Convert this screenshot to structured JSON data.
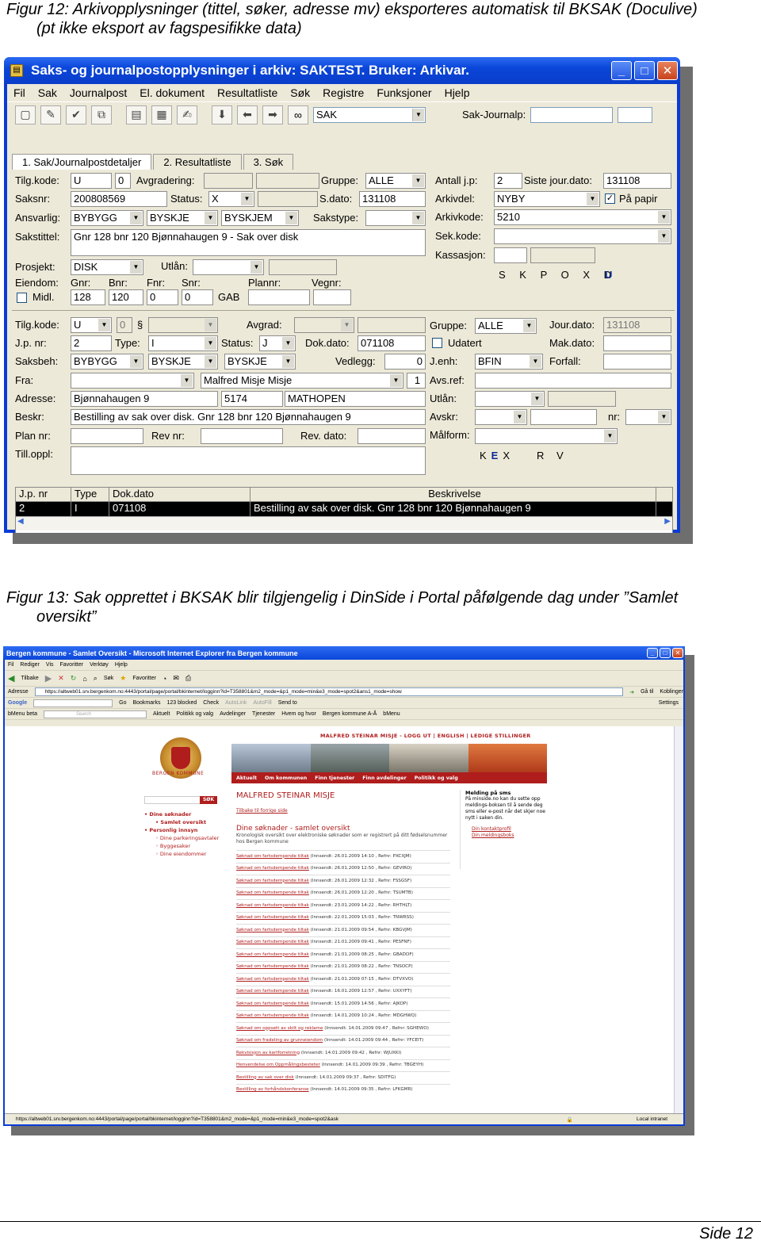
{
  "captions": {
    "fig12_line1": "Figur 12: Arkivopplysninger (tittel, søker, adresse mv) eksporteres automatisk til BKSAK (Doculive)",
    "fig12_line2": "(pt ikke eksport av fagspesifikke data)",
    "fig13_line1": "Figur 13: Sak opprettet i BKSAK blir tilgjengelig i DinSide i Portal påfølgende dag under ”Samlet",
    "fig13_line2": "oversikt”"
  },
  "footer": {
    "page": "Side 12"
  },
  "win1": {
    "title": "Saks- og journalpostopplysninger i arkiv: SAKTEST. Bruker: Arkivar.",
    "menu": [
      "Fil",
      "Sak",
      "Journalpost",
      "El. dokument",
      "Resultatliste",
      "Søk",
      "Registre",
      "Funksjoner",
      "Hjelp"
    ],
    "toolbar": {
      "combo_value": "SAK",
      "sakjournalp_label": "Sak-Journalp:"
    },
    "tabs": [
      "1. Sak/Journalpostdetaljer",
      "2. Resultatliste",
      "3. Søk"
    ],
    "sak": {
      "tilgkode_label": "Tilg.kode:",
      "tilgkode_value": "U",
      "tilgkode_num": "0",
      "avgradering_label": "Avgradering:",
      "gruppe_label": "Gruppe:",
      "gruppe_value": "ALLE",
      "antall_jp_label": "Antall j.p:",
      "antall_jp_value": "2",
      "siste_jour_label": "Siste jour.dato:",
      "siste_jour_value": "131108",
      "saksnr_label": "Saksnr:",
      "saksnr_value": "200808569",
      "status_label": "Status:",
      "status_value": "X",
      "sdato_label": "S.dato:",
      "sdato_value": "131108",
      "arkivdel_label": "Arkivdel:",
      "arkivdel_value": "NYBY",
      "paa_papir_label": "På papir",
      "ansvarlig_label": "Ansvarlig:",
      "ansvarlig_1": "BYBYGG",
      "ansvarlig_2": "BYSKJE",
      "ansvarlig_3": "BYSKJEM",
      "sakstype_label": "Sakstype:",
      "arkivkode_label": "Arkivkode:",
      "arkivkode_value": "5210",
      "sakstittel_label": "Sakstittel:",
      "sakstittel_value": "Gnr 128 bnr 120 Bjønnahaugen 9 - Sak over disk",
      "sekkode_label": "Sek.kode:",
      "kassasjon_label": "Kassasjon:",
      "prosjekt_label": "Prosjekt:",
      "prosjekt_value": "DISK",
      "utlan_label": "Utlån:",
      "skpoxd": "S K P O X D",
      "u_letter": "U",
      "eiendom_label": "Eiendom:",
      "gnr_label": "Gnr:",
      "bnr_label": "Bnr:",
      "fnr_label": "Fnr:",
      "snr_label": "Snr:",
      "plannr_label": "Plannr:",
      "vegnr_label": "Vegnr:",
      "midl_label": "Midl.",
      "gnr_value": "128",
      "bnr_value": "120",
      "fnr_value": "0",
      "snr_value": "0",
      "gab_label": "GAB"
    },
    "jp": {
      "tilgkode_label": "Tilg.kode:",
      "tilgkode_value": "U",
      "tilgkode_num": "0",
      "paragraph": "§",
      "avgrad_label": "Avgrad:",
      "gruppe_label": "Gruppe:",
      "gruppe_value": "ALLE",
      "jourdato_label": "Jour.dato:",
      "jourdato_value": "131108",
      "jpnr_label": "J.p. nr:",
      "jpnr_value": "2",
      "type_label": "Type:",
      "type_value": "I",
      "status_label": "Status:",
      "status_value": "J",
      "dokdato_label": "Dok.dato:",
      "dokdato_value": "071108",
      "udatert_label": "Udatert",
      "makdato_label": "Mak.dato:",
      "saksbeh_label": "Saksbeh:",
      "saksbeh_1": "BYBYGG",
      "saksbeh_2": "BYSKJE",
      "saksbeh_3": "BYSKJE",
      "vedlegg_label": "Vedlegg:",
      "vedlegg_value": "0",
      "jenh_label": "J.enh:",
      "jenh_value": "BFIN",
      "forfall_label": "Forfall:",
      "fra_label": "Fra:",
      "fra_value": "Malfred Misje Misje",
      "fra_num": "1",
      "avsref_label": "Avs.ref:",
      "adresse_label": "Adresse:",
      "adresse_value": "Bjønnahaugen 9",
      "postnr_value": "5174",
      "poststed_value": "MATHOPEN",
      "utlan_label": "Utlån:",
      "beskr_label": "Beskr:",
      "beskr_value": "Bestilling av sak over disk. Gnr 128 bnr 120 Bjønnahaugen 9",
      "avskr_label": "Avskr:",
      "nr_label": "nr:",
      "plannr_label": "Plan nr:",
      "revnr_label": "Rev nr:",
      "revdato_label": "Rev. dato:",
      "malform_label": "Målform:",
      "tilloppl_label": "Till.oppl:",
      "kex_k": "K",
      "kex_e": "E",
      "kex_x": "X",
      "rv": "R V"
    },
    "grid": {
      "headers": [
        "J.p. nr",
        "Type",
        "Dok.dato",
        "Beskrivelse"
      ],
      "rows": [
        [
          "2",
          "I",
          "071108",
          "Bestilling av sak over disk. Gnr 128 bnr 120 Bjønnahaugen 9"
        ]
      ]
    }
  },
  "win2": {
    "title": "Bergen kommune - Samlet Oversikt - Microsoft Internet Explorer fra Bergen kommune",
    "menu": [
      "Fil",
      "Rediger",
      "Vis",
      "Favoritter",
      "Verktøy",
      "Hjelp"
    ],
    "nav": [
      "Tilbake",
      "Søk",
      "Favoritter"
    ],
    "address_label": "Adresse",
    "address": "https://altweb01.srv.bergenkom.no:4443/portal/page/portal/bkinternet/logginn?id=T358801&m2_mode=&p1_mode=min&e3_mode=spot2&ans1_mode=show",
    "goto": "Gå til",
    "links_label": "Koblinger",
    "google_row": [
      "Google",
      "Go",
      "Bookmarks",
      "123 blocked",
      "Check",
      "AutoLink",
      "AutoFill",
      "Send to",
      "Settings"
    ],
    "bmenu_row": [
      "bMenu beta",
      "Search",
      "Aktuelt",
      "Politikk og valg",
      "Avdelinger",
      "Tjenester",
      "Hvem og hvor",
      "Bergen kommune A-Å",
      "bMenu"
    ],
    "status_url": "https://altweb01.srv.bergenkom.no:4443/portal/page/portal/bkinternet/logginn?id=T358801&m2_mode=&p1_mode=min&e3_mode=spot2&ask",
    "zone": "Local intranet"
  },
  "bk": {
    "topbar": "MALFRED STEINAR MISJE - LOGG UT  |  ENGLISH  |  LEDIGE STILLINGER",
    "kommune": "BERGEN KOMMUNE",
    "nav": [
      "Aktuelt",
      "Om kommunen",
      "Finn tjenester",
      "Finn avdelinger",
      "Politikk og valg"
    ],
    "sok": "SØK",
    "left_nav": {
      "r1": "Dine søknader",
      "s1": "Samlet oversikt",
      "r2": "Personlig innsyn",
      "s2": "Dine parkeringsavtaler",
      "s3": "Byggesaker",
      "s4": "Dine eiendommer"
    },
    "name": "MALFRED STEINAR MISJE",
    "back": "Tilbake til forrige side",
    "heading": "Dine søknader - samlet oversikt",
    "intro": "Kronologisk oversikt over elektroniske søknader som er registrert på ditt fødselsnummer hos Bergen kommune",
    "apps": [
      {
        "link": "Søknad om fartsdempende tiltak",
        "rest": " (Innsendt: 26.01.2009 14:10 , Refnr: PXCXJM)"
      },
      {
        "link": "Søknad om fartsdempende tiltak",
        "rest": " (Innsendt: 26.01.2009 12:50 , Refnr: GEVIRO)"
      },
      {
        "link": "Søknad om fartsdempende tiltak",
        "rest": " (Innsendt: 26.01.2009 12:32 , Refnr: FSSGSF)"
      },
      {
        "link": "Søknad om fartsdempende tiltak",
        "rest": " (Innsendt: 26.01.2009 12:20 , Refnr: TSUMTB)"
      },
      {
        "link": "Søknad om fartsdempende tiltak",
        "rest": " (Innsendt: 23.01.2009 14:22 , Refnr: RHTHLT)"
      },
      {
        "link": "Søknad om fartsdempende tiltak",
        "rest": " (Innsendt: 22.01.2009 15:03 , Refnr: TNWRSS)"
      },
      {
        "link": "Søknad om fartsdempende tiltak",
        "rest": " (Innsendt: 21.01.2009 09:54 , Refnr: KBGVJM)"
      },
      {
        "link": "Søknad om fartsdempende tiltak",
        "rest": " (Innsendt: 21.01.2009 09:41 , Refnr: PESFNF)"
      },
      {
        "link": "Søknad om fartsdempende tiltak",
        "rest": " (Innsendt: 21.01.2009 08:25 , Refnr: GBADOF)"
      },
      {
        "link": "Søknad om fartsdempende tiltak",
        "rest": " (Innsendt: 21.01.2009 08:22 , Refnr: TNSOCP)"
      },
      {
        "link": "Søknad om fartsdempende tiltak",
        "rest": " (Innsendt: 21.01.2009 07:15 , Refnr: DTVXVO)"
      },
      {
        "link": "Søknad om fartsdempende tiltak",
        "rest": " (Innsendt: 16.01.2009 12:57 , Refnr: UXXYFT)"
      },
      {
        "link": "Søknad om fartsdempende tiltak",
        "rest": " (Innsendt: 15.01.2009 14:56 , Refnr: AJKOP)"
      },
      {
        "link": "Søknad om fartsdempende tiltak",
        "rest": " (Innsendt: 14.01.2009 10:24 , Refnr: MDGHWQ)"
      },
      {
        "link": "Søknad om oppsett av skilt og reklame",
        "rest": " (Innsendt: 14.01.2009 09:47 , Refnr: SGHEWO)"
      },
      {
        "link": "Søknad om fradeling av grunneiendom",
        "rest": " (Innsendt: 14.01.2009 09:44 , Refnr: YFCEIT)"
      },
      {
        "link": "Rekvisisjon av kartforretning",
        "rest": " (Innsendt: 14.01.2009 09:42 , Refnr: WJUXKI)"
      },
      {
        "link": "Henvendelse om Oppmålingsbesteter",
        "rest": " (Innsendt: 14.01.2009 09:39 , Refnr: TBGEYH)"
      },
      {
        "link": "Bestilling av sak over disk",
        "rest": " (Innsendt: 14.01.2009 09:37 , Refnr: SDITFG)"
      },
      {
        "link": "Bestilling av forhåndskonferanse",
        "rest": " (Innsendt: 14.01.2009 09:35 , Refnr: LFKGMR)"
      }
    ],
    "side": {
      "title": "Melding på sms",
      "text": "På minside.no kan du sette opp meldings-boksen til å sende deg sms eller e-post når det skjer noe nytt i saken din.",
      "link1": "Din kontaktprofil",
      "link2": "Din meldingsboks"
    }
  }
}
